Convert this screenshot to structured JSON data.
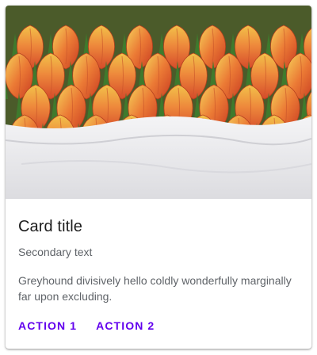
{
  "card": {
    "image": {
      "icon": "tulip-bouquet-photo",
      "accent": "#e4642a"
    },
    "title": "Card title",
    "secondary": "Secondary text",
    "body": "Greyhound divisively hello coldly wonderfully marginally far upon excluding.",
    "actions": [
      {
        "label": "ACTION 1",
        "color": "#6200ee"
      },
      {
        "label": "ACTION 2",
        "color": "#6200ee"
      }
    ]
  }
}
